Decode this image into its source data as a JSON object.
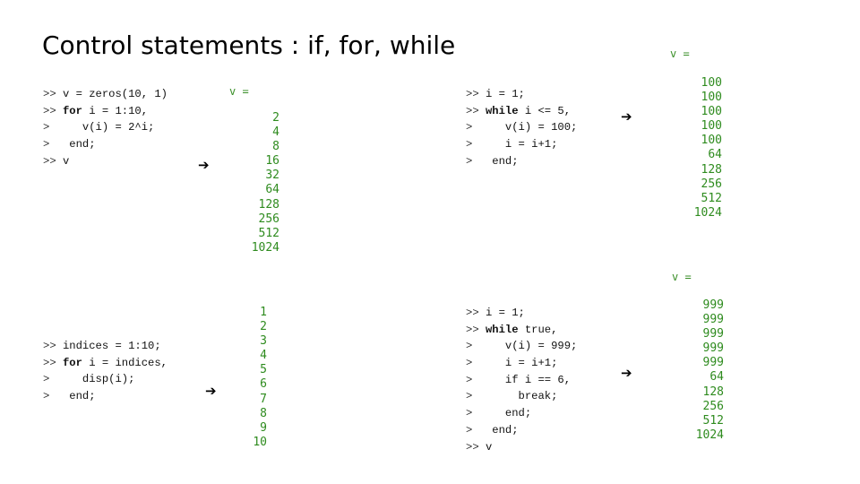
{
  "slide": {
    "title": "Control statements : if, for, while"
  },
  "colors": {
    "output_green": "#2e8b1e",
    "code_text": "#111111",
    "title": "#000000"
  },
  "icons": {
    "arrow": "right-arrow-icon"
  },
  "arrow_glyph": "➔",
  "blocks": {
    "for_loop_power": {
      "code": [
        {
          "prompt": ">>",
          "kw": "",
          "rest": "v = zeros(10, 1)"
        },
        {
          "prompt": ">>",
          "kw": "for",
          "rest": " i = 1:10,"
        },
        {
          "prompt": "> ",
          "kw": "",
          "rest": "   v(i) = 2^i;"
        },
        {
          "prompt": "> ",
          "kw": "",
          "rest": " end;"
        },
        {
          "prompt": ">>",
          "kw": "",
          "rest": "v"
        }
      ],
      "output_label": "v =",
      "output": [
        "2",
        "4",
        "8",
        "16",
        "32",
        "64",
        "128",
        "256",
        "512",
        "1024"
      ]
    },
    "while_loop_counter": {
      "code": [
        {
          "prompt": ">>",
          "kw": "",
          "rest": "i = 1;"
        },
        {
          "prompt": ">>",
          "kw": "while",
          "rest": " i <= 5,"
        },
        {
          "prompt": "> ",
          "kw": "",
          "rest": "   v(i) = 100;"
        },
        {
          "prompt": "> ",
          "kw": "",
          "rest": "   i = i+1;"
        },
        {
          "prompt": "> ",
          "kw": "",
          "rest": " end;"
        }
      ],
      "output_label": "v =",
      "output": [
        "100",
        "100",
        "100",
        "100",
        "100",
        "64",
        "128",
        "256",
        "512",
        "1024"
      ]
    },
    "for_loop_disp": {
      "code": [
        {
          "prompt": ">>",
          "kw": "",
          "rest": "indices = 1:10;"
        },
        {
          "prompt": ">>",
          "kw": "for",
          "rest": " i = indices,"
        },
        {
          "prompt": "> ",
          "kw": "",
          "rest": "   disp(i);"
        },
        {
          "prompt": "> ",
          "kw": "",
          "rest": " end;"
        }
      ],
      "output": [
        "1",
        "2",
        "3",
        "4",
        "5",
        "6",
        "7",
        "8",
        "9",
        "10"
      ]
    },
    "while_true_break": {
      "code": [
        {
          "prompt": ">>",
          "kw": "",
          "rest": "i = 1;"
        },
        {
          "prompt": ">>",
          "kw": "while",
          "rest": " true,"
        },
        {
          "prompt": "> ",
          "kw": "",
          "rest": "   v(i) = 999;"
        },
        {
          "prompt": "> ",
          "kw": "",
          "rest": "   i = i+1;"
        },
        {
          "prompt": "> ",
          "kw": "",
          "rest": "   if i == 6,"
        },
        {
          "prompt": "> ",
          "kw": "",
          "rest": "     break;"
        },
        {
          "prompt": "> ",
          "kw": "",
          "rest": "   end;"
        },
        {
          "prompt": "> ",
          "kw": "",
          "rest": " end;"
        },
        {
          "prompt": ">>",
          "kw": "",
          "rest": "v"
        }
      ],
      "output_label": "v =",
      "output": [
        "999",
        "999",
        "999",
        "999",
        "999",
        "64",
        "128",
        "256",
        "512",
        "1024"
      ]
    }
  }
}
